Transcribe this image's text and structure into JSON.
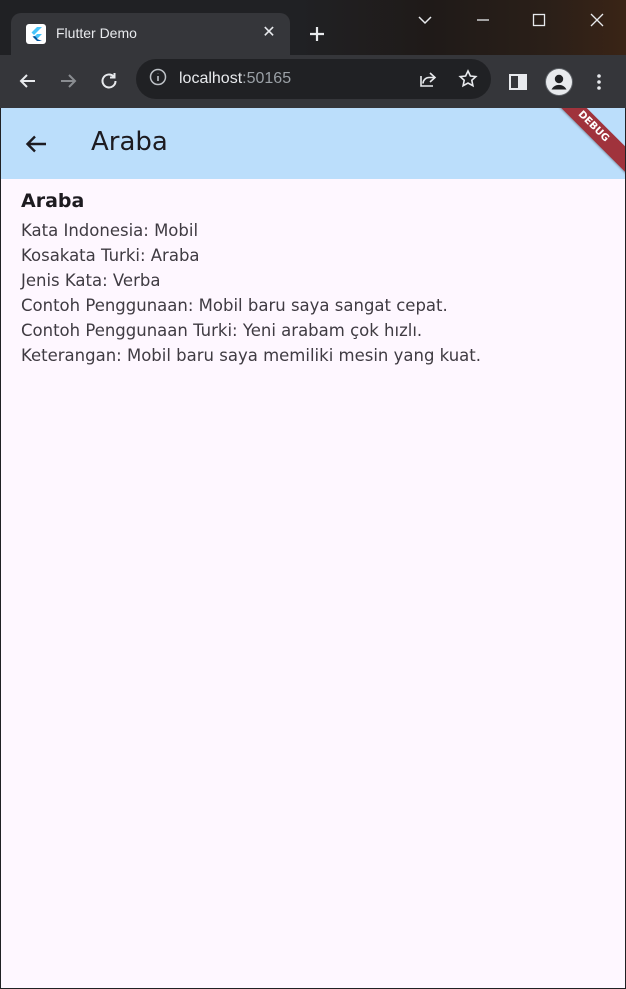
{
  "browser": {
    "tab_title": "Flutter Demo",
    "close_tab_glyph": "✕",
    "url_host": "localhost",
    "url_port": ":50165"
  },
  "icons": {
    "favicon": "flutter-logo",
    "back": "arrow-left-icon",
    "forward": "arrow-right-icon",
    "reload": "reload-icon",
    "info": "info-icon",
    "share": "share-icon",
    "star": "star-icon",
    "sidepanel": "side-panel-icon",
    "profile": "profile-icon",
    "menu": "kebab-menu-icon"
  },
  "app": {
    "appbar_title": "Araba",
    "debug_banner": "DEBUG",
    "colors": {
      "appbar_bg": "#bbdefb",
      "page_bg": "#fef7ff",
      "debug_ribbon": "#a0333c"
    },
    "word": {
      "title": "Araba",
      "details": [
        "Kata Indonesia: Mobil",
        "Kosakata Turki: Araba",
        "Jenis Kata: Verba",
        "Contoh Penggunaan: Mobil baru saya sangat cepat.",
        "Contoh Penggunaan Turki: Yeni arabam çok hızlı.",
        "Keterangan: Mobil baru saya memiliki mesin yang kuat."
      ]
    }
  }
}
